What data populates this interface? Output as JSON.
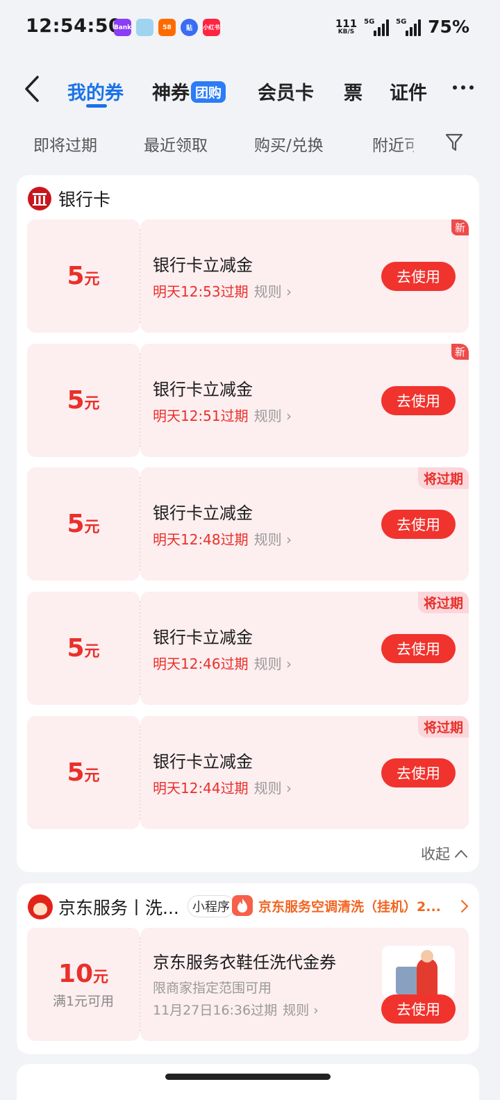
{
  "status_bar": {
    "time": "12:54:50",
    "apps": [
      {
        "name": "bank-app-icon",
        "label": "Bank",
        "color": "#8b3cf6"
      },
      {
        "name": "anime-app-icon",
        "label": "",
        "color": "#9fd4f0"
      },
      {
        "name": "58-app-icon",
        "label": "58",
        "color": "#ff6a00"
      },
      {
        "name": "tieba-app-icon",
        "label": "贴",
        "color": "#3a6cf4"
      },
      {
        "name": "xiaohongshu-app-icon",
        "label": "小红书",
        "color": "#ff2442"
      }
    ],
    "net_speed_value": "111",
    "net_speed_unit": "KB/S",
    "signal1_label": "5G",
    "signal2_label": "5G",
    "battery": "75%"
  },
  "nav": {
    "tabs": [
      {
        "label": "我的券",
        "active": true
      },
      {
        "label": "神券",
        "badge": "团购"
      },
      {
        "label": "会员卡"
      },
      {
        "label": "票"
      },
      {
        "label": "证件"
      }
    ]
  },
  "filters": [
    "即将过期",
    "最近领取",
    "购买/兑换",
    "附近可用"
  ],
  "bank_section": {
    "title": "银行卡",
    "collapse_label": "收起",
    "coupons": [
      {
        "amount": "5",
        "unit": "元",
        "title": "银行卡立减金",
        "expire": "明天12:53过期",
        "rule": "规则",
        "button": "去使用",
        "tag": "新",
        "tag_type": "new"
      },
      {
        "amount": "5",
        "unit": "元",
        "title": "银行卡立减金",
        "expire": "明天12:51过期",
        "rule": "规则",
        "button": "去使用",
        "tag": "新",
        "tag_type": "new"
      },
      {
        "amount": "5",
        "unit": "元",
        "title": "银行卡立减金",
        "expire": "明天12:48过期",
        "rule": "规则",
        "button": "去使用",
        "tag": "将过期",
        "tag_type": "expiring"
      },
      {
        "amount": "5",
        "unit": "元",
        "title": "银行卡立减金",
        "expire": "明天12:46过期",
        "rule": "规则",
        "button": "去使用",
        "tag": "将过期",
        "tag_type": "expiring"
      },
      {
        "amount": "5",
        "unit": "元",
        "title": "银行卡立减金",
        "expire": "明天12:44过期",
        "rule": "规则",
        "button": "去使用",
        "tag": "将过期",
        "tag_type": "expiring"
      }
    ]
  },
  "jd_section": {
    "title": "京东服务丨洗...",
    "mini_program_label": "小程序",
    "ad_text": "京东服务空调清洗（挂机）2...",
    "coupon": {
      "amount": "10",
      "unit": "元",
      "condition": "满1元可用",
      "title": "京东服务衣鞋任洗代金券",
      "scope": "限商家指定范围可用",
      "expire": "11月27日16:36过期",
      "rule": "规则",
      "button": "去使用"
    }
  },
  "colors": {
    "accent": "#1a73e8",
    "red": "#e9302a",
    "button": "#f0332d",
    "coupon_bg": "#fdeef0",
    "page_bg": "#f2f3f7"
  }
}
